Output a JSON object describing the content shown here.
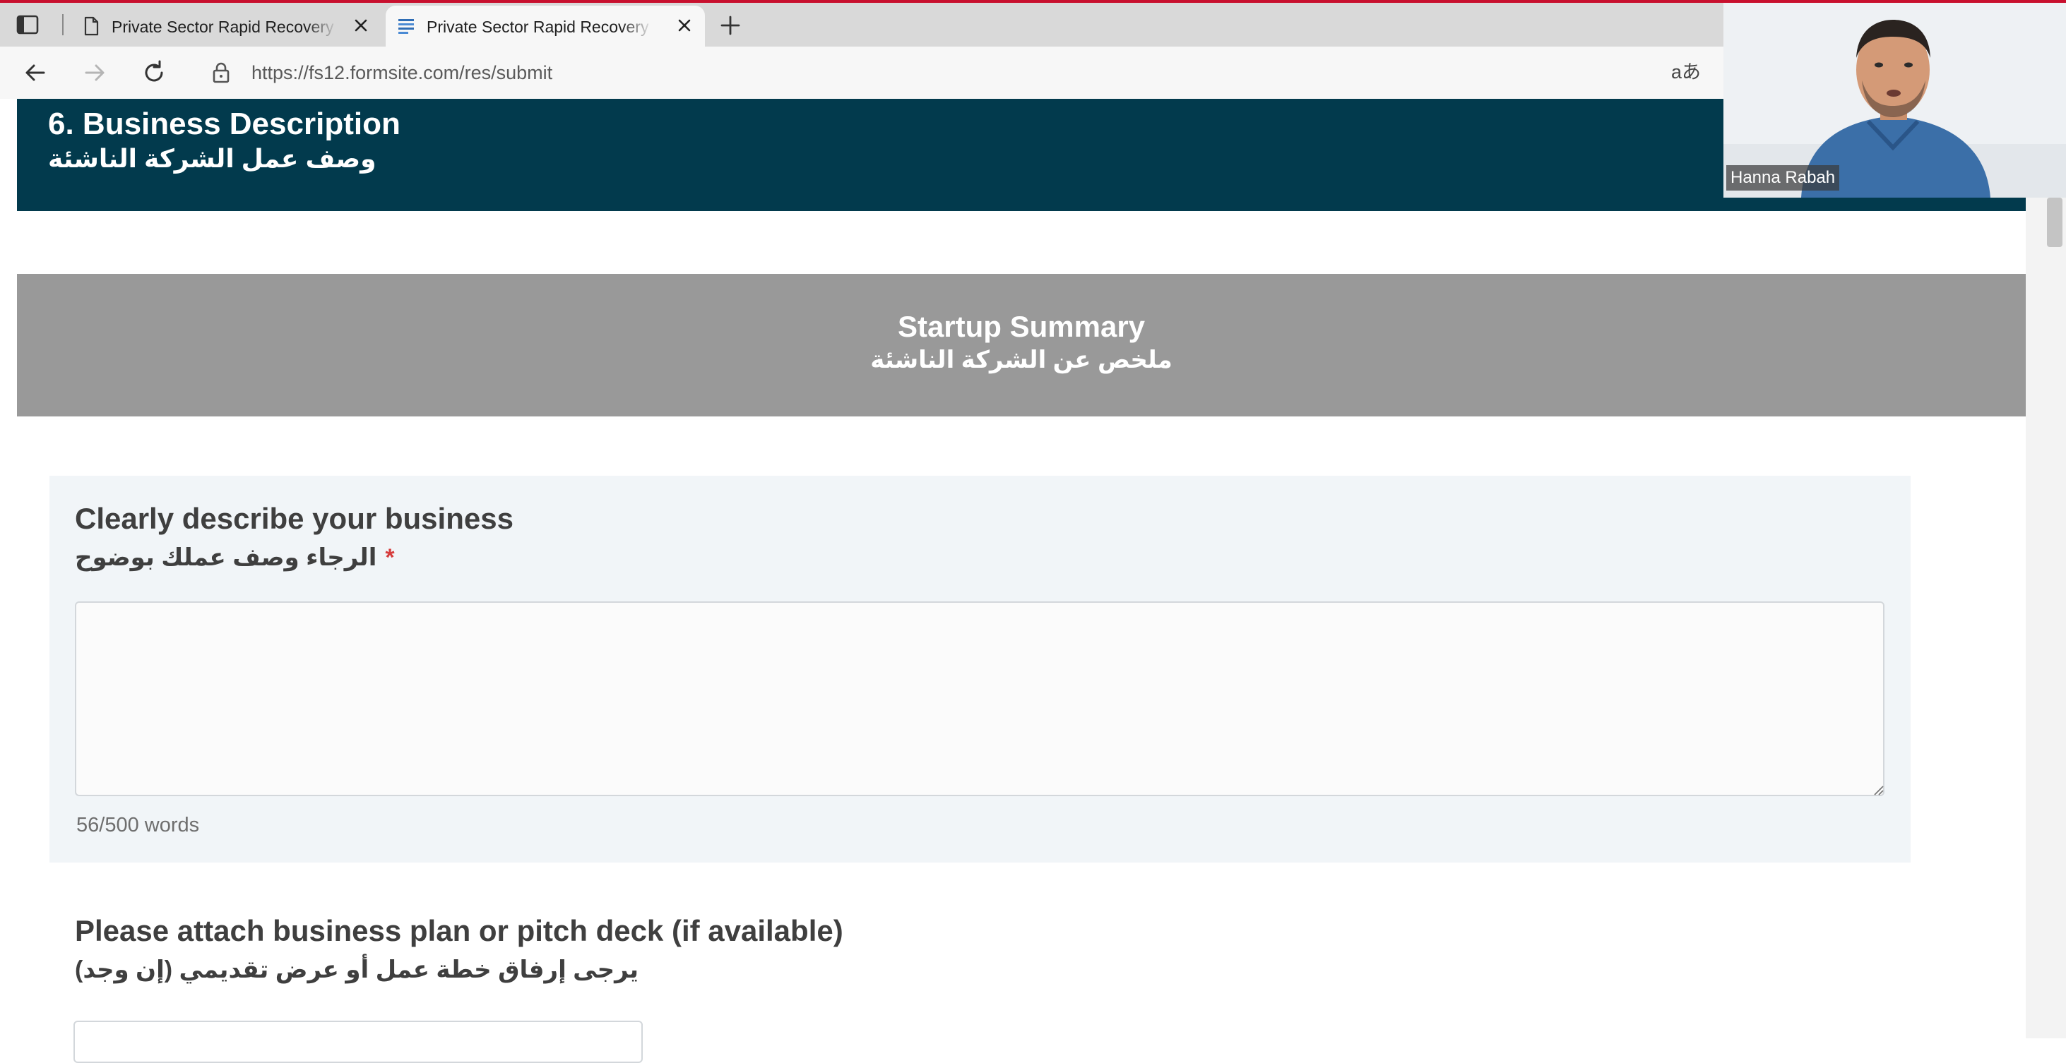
{
  "browser": {
    "tabs": [
      {
        "title": "Private Sector Rapid Recovery Program",
        "active": false,
        "favicon": "document-icon"
      },
      {
        "title": "Private Sector Rapid Recovery Program",
        "active": true,
        "favicon": "form-icon"
      }
    ],
    "url": "https://fs12.formsite.com/res/submit",
    "read_aloud_label": "aあ"
  },
  "section": {
    "title_en": "6. Business Description",
    "title_ar": "وصف عمل الشركة الناشئة"
  },
  "summary": {
    "title_en": "Startup Summary",
    "title_ar": "ملخص عن الشركة الناشئة"
  },
  "question1": {
    "label_en": "Clearly describe your business",
    "label_ar": "الرجاء وصف عملك بوضوح",
    "required_mark": "*",
    "value": "",
    "word_count": "56/500 words"
  },
  "question2": {
    "label_en": "Please attach business plan or pitch deck (if available)",
    "label_ar": "يرجى إرفاق خطة عمل أو عرض تقديمي (إن وجد)"
  },
  "video": {
    "participant_name": "Hanna Rabah"
  },
  "colors": {
    "header_bg": "#023a4d",
    "summary_bg": "#999999",
    "field_bg": "#f1f5f8",
    "required": "#d63c3c"
  }
}
